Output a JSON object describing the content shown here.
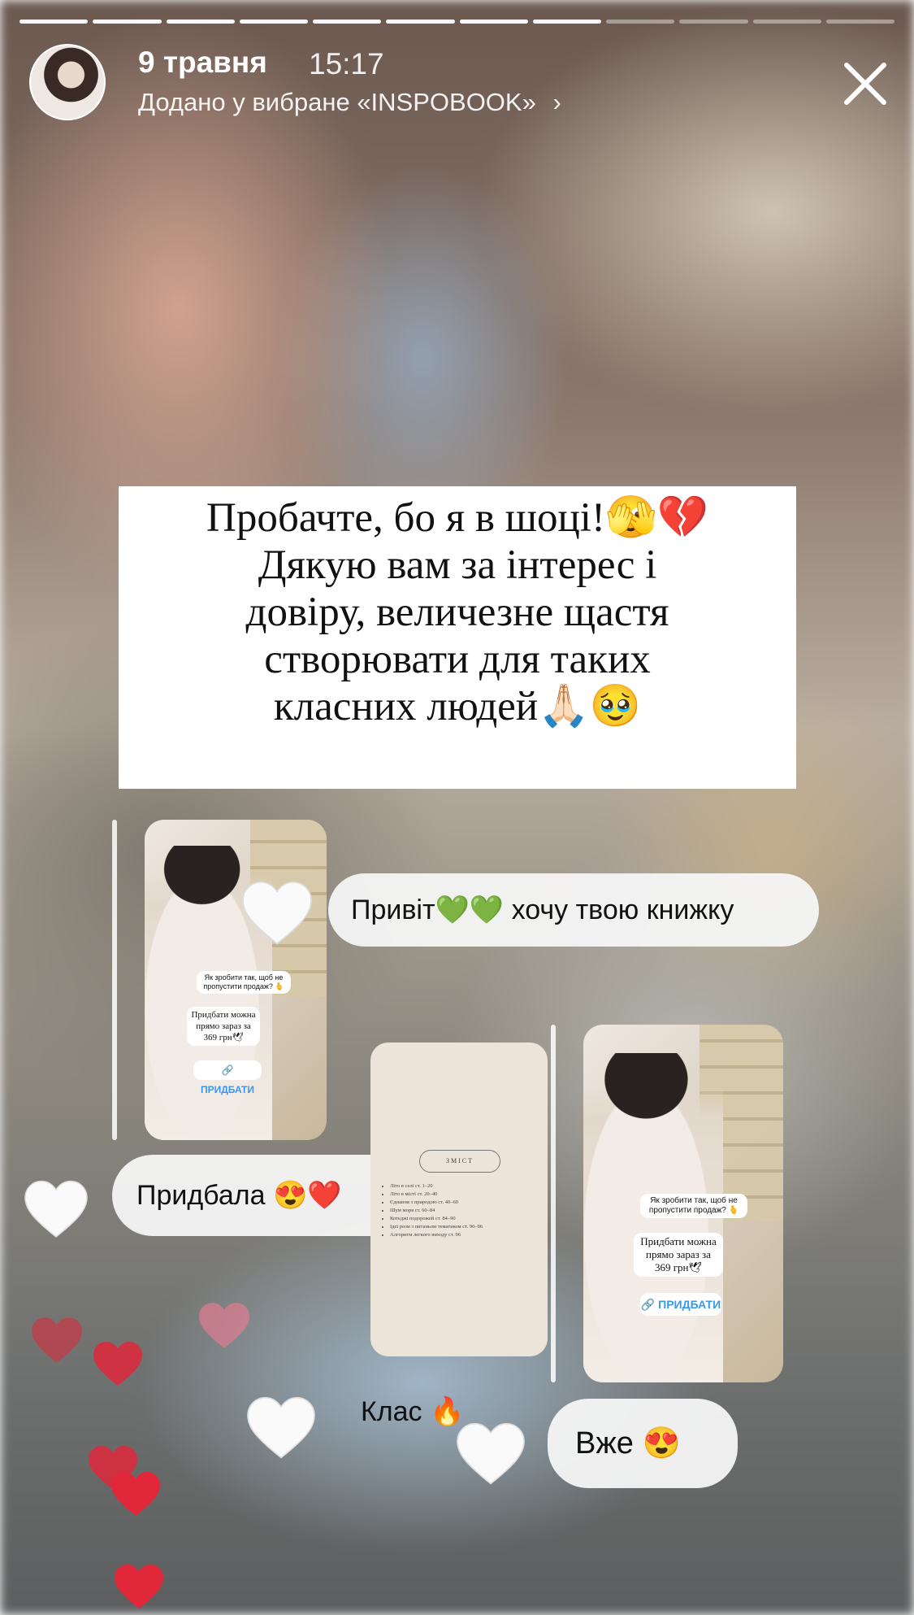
{
  "header": {
    "date": "9 травня",
    "time": "15:17",
    "subtitle": "Додано у вибране «INSPOBOOK»",
    "chevron": "›",
    "progress_segments": 12,
    "progress_done": 8
  },
  "story_text": [
    "Пробачте, бо я в шоці!🫣💔",
    "Дякую вам за інтерес і",
    "довіру,  величезне щастя",
    "створювати для таких",
    "класних людей🙏🏻🥹"
  ],
  "thumb_left": {
    "question": "Як зробити так, щоб не пропустити продаж? 🫰",
    "offer_lines": [
      "Придбати можна",
      "прямо зараз за",
      "369 грн🕊"
    ],
    "buy_label": "ПРИДБАТИ"
  },
  "thumb_right": {
    "question": "Як зробити так, щоб не пропустити продаж? 🫰",
    "offer_lines": [
      "Придбати можна",
      "прямо зараз за",
      "369 грн🕊"
    ],
    "buy_label": "ПРИДБАТИ"
  },
  "toc": {
    "title": "ЗМІСТ",
    "items": [
      "Літо в селі ст. 1–20",
      "Літо в місті ст. 20–40",
      "Єднання з природою ст. 40–60",
      "Шум моря ст. 60–84",
      "Котеджі подорожей ст. 84–90",
      "Ідеї розм з питаньом тематиком ст. 90–96",
      "Алгоритм легкого виходу ст. 96"
    ]
  },
  "messages": {
    "m1": "Привіт💚💚 хочу твою книжку",
    "m2": "Придбала 😍❤️",
    "m3": "Клас 🔥",
    "m4": "Вже 😍"
  },
  "colors": {
    "reaction_heart_red": "#e0283a",
    "reaction_heart_pink": "#f27c93",
    "white_heart": "#ffffff",
    "link_blue": "#3897f0"
  }
}
